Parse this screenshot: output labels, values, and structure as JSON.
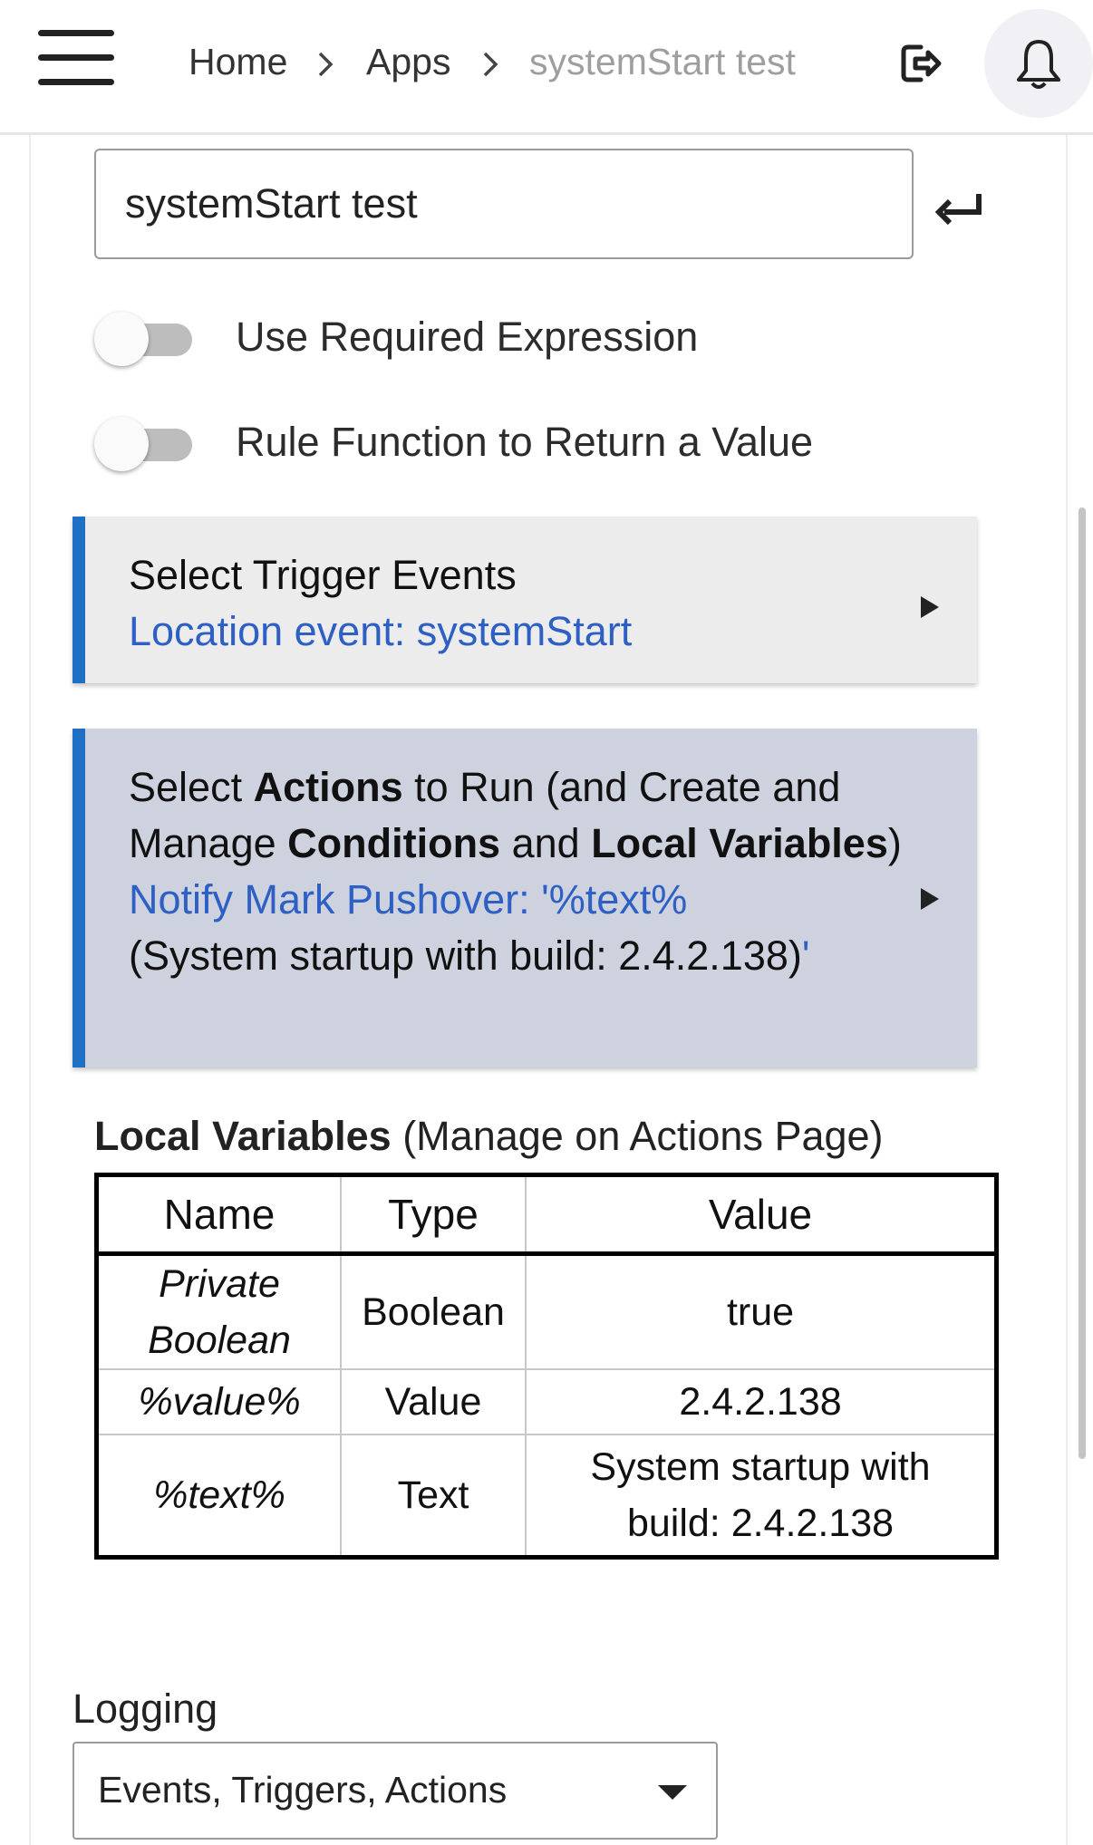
{
  "header": {
    "breadcrumbs": [
      {
        "label": "Home"
      },
      {
        "label": "Apps"
      },
      {
        "label": "systemStart test"
      }
    ]
  },
  "form": {
    "app_name_value": "systemStart test",
    "toggles": [
      {
        "label": "Use Required Expression",
        "on": false
      },
      {
        "label": "Rule Function to Return a Value",
        "on": false
      }
    ]
  },
  "trigger_card": {
    "title": "Select Trigger Events",
    "summary": "Location event: systemStart"
  },
  "actions_card": {
    "t1": "Select ",
    "b1": "Actions",
    "t2": " to Run (and Create and Manage ",
    "b2": "Conditions",
    "t3": " and ",
    "b3": "Local Variables",
    "t4": ")",
    "summary_blue": "Notify Mark Pushover: '%text%",
    "summary_black": "(System startup with build: 2.4.2.138)",
    "summary_quote": "'"
  },
  "local_variables": {
    "heading_bold": "Local Variables",
    "heading_rest": " (Manage on Actions Page)",
    "columns": [
      "Name",
      "Type",
      "Value"
    ],
    "rows": [
      {
        "name": "Private Boolean",
        "type": "Boolean",
        "value": "true"
      },
      {
        "name": "%value%",
        "type": "Value",
        "value": "2.4.2.138"
      },
      {
        "name": "%text%",
        "type": "Text",
        "value": "System startup with build: 2.4.2.138"
      }
    ]
  },
  "logging": {
    "label": "Logging",
    "selected": "Events, Triggers, Actions"
  },
  "colors": {
    "accent": "#1f6fc5",
    "link_blue": "#2d5fc4",
    "trigger_card_bg": "#ececec",
    "actions_card_bg": "#cdd2de"
  },
  "icons": [
    "hamburger-menu-icon",
    "chevron-right-icon",
    "logout-icon",
    "bell-icon",
    "enter-icon",
    "play-arrow-icon",
    "dropdown-caret-icon"
  ]
}
